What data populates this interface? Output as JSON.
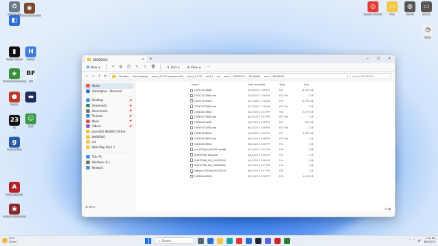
{
  "desktop": {
    "icons_left": [
      {
        "label": "Recycle Bin",
        "color": "#6b7b8c",
        "glyph": "♻"
      },
      {
        "label": "Eastern Screenshot",
        "color": "#7a4a2a",
        "glyph": "◉"
      },
      {
        "label": "",
        "color": "#2d6fd6",
        "glyph": "◧"
      },
      {
        "label": "Roblox Studio",
        "color": "#111111",
        "glyph": "▮"
      },
      {
        "label": "Hollow",
        "color": "#3d7ee0",
        "glyph": "H"
      },
      {
        "label": "Minecraft Launcher",
        "color": "#3b8f3b",
        "glyph": "◈"
      },
      {
        "label": "BFF",
        "color": "#e8f2ff",
        "glyph": "BF"
      },
      {
        "label": "Gamer",
        "color": "#c0392b",
        "glyph": "●"
      },
      {
        "label": "",
        "color": "#222b5a",
        "glyph": "▬"
      },
      {
        "label": "23",
        "color": "#111111",
        "glyph": "23"
      },
      {
        "label": "Golf",
        "color": "#3a9a4a",
        "glyph": "☺"
      },
      {
        "label": "Garry's Mod",
        "color": "#2a5ca8",
        "glyph": "g"
      },
      {
        "label": "Apex Legends",
        "color": "#b1222a",
        "glyph": "A"
      },
      {
        "label": "Eastern Screenshot 2",
        "color": "#8b2a2a",
        "glyph": "◉"
      }
    ],
    "icons_right": [
      {
        "label": "Google Chrome",
        "color": "#e53935",
        "glyph": "◎"
      },
      {
        "label": "Files",
        "color": "#f4c542",
        "glyph": "▭"
      },
      {
        "label": "Steam",
        "color": "#555555",
        "glyph": "◍"
      },
      {
        "label": "Server",
        "color": "#555555",
        "glyph": "▭"
      },
      {
        "label": "Clock",
        "color": "#f0f0f0",
        "glyph": "◷"
      }
    ]
  },
  "window": {
    "tab_title": "80000001",
    "new_label": "New",
    "sort_label": "Sort",
    "view_label": "View",
    "breadcrumbs": [
      "Desktop",
      "Alex Garbage",
      "cemu_2.0-31-windows-x64",
      "Cemu_2.0-31",
      "mlc01",
      "usr",
      "save",
      "00050000",
      "101d9d00",
      "user",
      "80000001"
    ],
    "search_placeholder": "Search 80000001",
    "sidebar": [
      {
        "label": "Home",
        "color": "#e05a2b",
        "active": true,
        "pin": false
      },
      {
        "label": "christopher - Personal",
        "color": "#1e6fd9",
        "active": false,
        "pin": false
      },
      {
        "gap": true
      },
      {
        "label": "Desktop",
        "color": "#3d8fe0",
        "pin": true
      },
      {
        "label": "Downloads",
        "color": "#2b8a57",
        "pin": true
      },
      {
        "label": "Documents",
        "color": "#6d6d6d",
        "pin": true
      },
      {
        "label": "Pictures",
        "color": "#2a8fd0",
        "pin": true
      },
      {
        "label": "Music",
        "color": "#d94d4d",
        "pin": true
      },
      {
        "label": "Videos",
        "color": "#8a55c9",
        "pin": true
      },
      {
        "label": "Janec0223N2837139.bin",
        "color": "#f4c542",
        "pin": false
      },
      {
        "label": "80000001",
        "color": "#f4c542",
        "pin": false
      },
      {
        "label": "usr",
        "color": "#f4c542",
        "pin": false
      },
      {
        "label": "Wide Map Pack 3",
        "color": "#f4c542",
        "pin": false
      },
      {
        "sep": true
      },
      {
        "label": "This PC",
        "color": "#3d8fe0",
        "pin": false
      },
      {
        "label": "Windows (C:)",
        "color": "#6d6d6d",
        "pin": false
      },
      {
        "label": "Network",
        "color": "#3d8fe0",
        "pin": false
      }
    ],
    "columns": {
      "name": "Name",
      "date": "Date modified",
      "type": "Type",
      "size": "Size"
    },
    "files": [
      {
        "name": "230211123848",
        "date": "3/26/2023 1:56 PM",
        "type": "File",
        "size": "11,583 KB"
      },
      {
        "name": "230211123848.ext",
        "date": "3/26/2023 1:56 PM",
        "type": "EXT File",
        "size": "1 KB"
      },
      {
        "name": "230227071826",
        "date": "3/27/2023 7:18 AM",
        "type": "File",
        "size": "15,739 KB"
      },
      {
        "name": "230427071826.ext",
        "date": "3/31/2023 7:18 AM",
        "type": "EXT File",
        "size": "1 KB"
      },
      {
        "name": "230428210828",
        "date": "6/4/2023 12:07 PM",
        "type": "File",
        "size": "4,770 KB"
      },
      {
        "name": "230428770828.ext",
        "date": "6/4/2023 12:07 PM",
        "type": "EXT File",
        "size": "1 KB"
      },
      {
        "name": "230504013058",
        "date": "6/4/2023 12:06 PM",
        "type": "File",
        "size": "900 KB"
      },
      {
        "name": "230504013058.ext",
        "date": "6/4/2023 12:06 PM",
        "type": "EXT File",
        "size": "1 KB"
      },
      {
        "name": "230504130618",
        "date": "1/28/2023 3:22 PM",
        "type": "File",
        "size": "1,053 KB"
      },
      {
        "name": "230504130618.ext",
        "date": "6/4/2023 12:06 PM",
        "type": "EXT File",
        "size": "1 KB"
      },
      {
        "name": "230504130618",
        "date": "6/4/2023 12:06 PM",
        "type": "File",
        "size": "1 KB"
      },
      {
        "name": "ant_ST83b4c0913f11a4d68f01849a6d",
        "date": "3/31/2023 3:42 PM",
        "type": "File",
        "size": "1 KB"
      },
      {
        "name": "GHOST9KK_HEADER",
        "date": "6/4/2023 12:06 PM",
        "type": "File",
        "size": "1 KB"
      },
      {
        "name": "GHOST9KK_IDS_LIGHTHOUSE_WORLD",
        "date": "6/4/2023 12:06 PM",
        "type": "File",
        "size": "1 KB"
      },
      {
        "name": "GHOST9KK_IDS_INUNDERGROUND_WORLD",
        "date": "6/4/2023 12:17 PM",
        "type": "File",
        "size": "1 KB"
      },
      {
        "name": "options_ST83b4c0913f11a4d68f01484E",
        "date": "6/4/2023 12:07 PM",
        "type": "File",
        "size": "1 KB"
      },
      {
        "name": "230504130618",
        "date": "6/4/2023 12:06 PM",
        "type": "File",
        "size": "2,128 KB"
      }
    ],
    "status": "18 items"
  },
  "taskbar": {
    "weather_temp": "81°F",
    "weather_text": "Sunny",
    "search_label": "Search",
    "apps": [
      {
        "name": "task-view",
        "color": "#5a6470"
      },
      {
        "name": "widgets",
        "color": "#2b6fd6"
      },
      {
        "name": "file-explorer",
        "color": "#f4c542"
      },
      {
        "name": "edge",
        "color": "#1aa3a3"
      },
      {
        "name": "chrome",
        "color": "#e53935"
      },
      {
        "name": "store",
        "color": "#2b6fd6"
      },
      {
        "name": "steam",
        "color": "#1b2838"
      },
      {
        "name": "discord",
        "color": "#5865f2"
      },
      {
        "name": "app-red",
        "color": "#c62828"
      },
      {
        "name": "app-green",
        "color": "#2e7d32"
      }
    ],
    "time": "1:16 PM",
    "date": "6/4/2023"
  }
}
